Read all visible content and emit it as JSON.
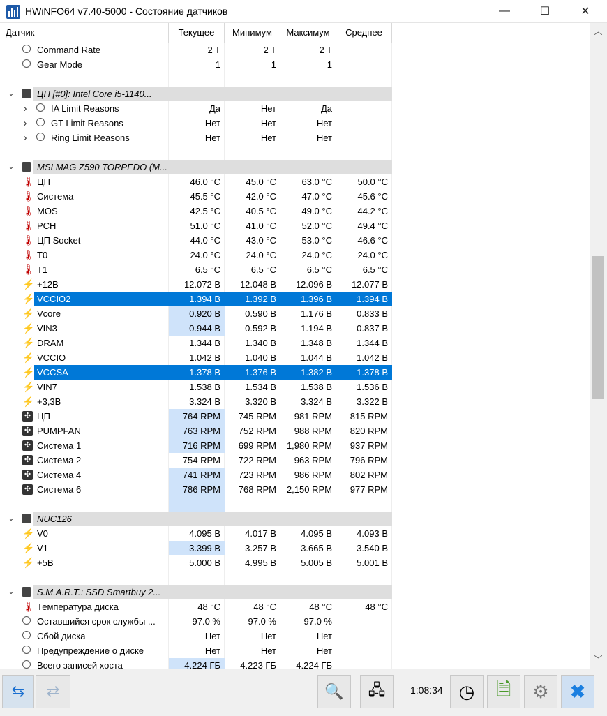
{
  "window": {
    "title": "HWiNFO64 v7.40-5000 - Состояние датчиков",
    "minimize": "—",
    "maximize": "☐",
    "close": "✕"
  },
  "columns": [
    "Датчик",
    "Текущее",
    "Минимум",
    "Максимум",
    "Среднее"
  ],
  "rows": [
    {
      "kind": "sensor",
      "icon": "clock",
      "name": "Command Rate",
      "v": [
        "2 T",
        "2 T",
        "2 T",
        ""
      ]
    },
    {
      "kind": "sensor",
      "icon": "clock",
      "name": "Gear Mode",
      "v": [
        "1",
        "1",
        "1",
        ""
      ]
    },
    {
      "kind": "spacer"
    },
    {
      "kind": "group",
      "name": "ЦП [#0]: Intel Core i5-1140..."
    },
    {
      "kind": "sensor",
      "icon": "clock",
      "expand": true,
      "name": "IA Limit Reasons",
      "v": [
        "Да",
        "Нет",
        "Да",
        ""
      ]
    },
    {
      "kind": "sensor",
      "icon": "clock",
      "expand": true,
      "name": "GT Limit Reasons",
      "v": [
        "Нет",
        "Нет",
        "Нет",
        ""
      ]
    },
    {
      "kind": "sensor",
      "icon": "clock",
      "expand": true,
      "name": "Ring Limit Reasons",
      "v": [
        "Нет",
        "Нет",
        "Нет",
        ""
      ]
    },
    {
      "kind": "spacer"
    },
    {
      "kind": "group",
      "name": "MSI MAG Z590 TORPEDO (M..."
    },
    {
      "kind": "sensor",
      "icon": "therm",
      "name": "ЦП",
      "v": [
        "46.0 °C",
        "45.0 °C",
        "63.0 °C",
        "50.0 °C"
      ]
    },
    {
      "kind": "sensor",
      "icon": "therm",
      "name": "Система",
      "v": [
        "45.5 °C",
        "42.0 °C",
        "47.0 °C",
        "45.6 °C"
      ]
    },
    {
      "kind": "sensor",
      "icon": "therm",
      "name": "MOS",
      "v": [
        "42.5 °C",
        "40.5 °C",
        "49.0 °C",
        "44.2 °C"
      ]
    },
    {
      "kind": "sensor",
      "icon": "therm",
      "name": "PCH",
      "v": [
        "51.0 °C",
        "41.0 °C",
        "52.0 °C",
        "49.4 °C"
      ]
    },
    {
      "kind": "sensor",
      "icon": "therm",
      "name": "ЦП Socket",
      "v": [
        "44.0 °C",
        "43.0 °C",
        "53.0 °C",
        "46.6 °C"
      ]
    },
    {
      "kind": "sensor",
      "icon": "therm",
      "name": "T0",
      "v": [
        "24.0 °C",
        "24.0 °C",
        "24.0 °C",
        "24.0 °C"
      ]
    },
    {
      "kind": "sensor",
      "icon": "therm",
      "name": "T1",
      "v": [
        "6.5 °C",
        "6.5 °C",
        "6.5 °C",
        "6.5 °C"
      ]
    },
    {
      "kind": "sensor",
      "icon": "bolt",
      "name": "+12В",
      "v": [
        "12.072 В",
        "12.048 В",
        "12.096 В",
        "12.077 В"
      ]
    },
    {
      "kind": "sensor",
      "icon": "bolt-gray",
      "selected": true,
      "name": "VCCIO2",
      "v": [
        "1.394 В",
        "1.392 В",
        "1.396 В",
        "1.394 В"
      ]
    },
    {
      "kind": "sensor",
      "icon": "bolt",
      "hl": true,
      "name": "Vcore",
      "v": [
        "0.920 В",
        "0.590 В",
        "1.176 В",
        "0.833 В"
      ]
    },
    {
      "kind": "sensor",
      "icon": "bolt",
      "hl": true,
      "name": "VIN3",
      "v": [
        "0.944 В",
        "0.592 В",
        "1.194 В",
        "0.837 В"
      ]
    },
    {
      "kind": "sensor",
      "icon": "bolt",
      "name": "DRAM",
      "v": [
        "1.344 В",
        "1.340 В",
        "1.348 В",
        "1.344 В"
      ]
    },
    {
      "kind": "sensor",
      "icon": "bolt",
      "name": "VCCIO",
      "v": [
        "1.042 В",
        "1.040 В",
        "1.044 В",
        "1.042 В"
      ]
    },
    {
      "kind": "sensor",
      "icon": "bolt-gray",
      "selected": true,
      "name": "VCCSA",
      "v": [
        "1.378 В",
        "1.376 В",
        "1.382 В",
        "1.378 В"
      ]
    },
    {
      "kind": "sensor",
      "icon": "bolt",
      "name": "VIN7",
      "v": [
        "1.538 В",
        "1.534 В",
        "1.538 В",
        "1.536 В"
      ]
    },
    {
      "kind": "sensor",
      "icon": "bolt",
      "name": "+3,3В",
      "v": [
        "3.324 В",
        "3.320 В",
        "3.324 В",
        "3.322 В"
      ]
    },
    {
      "kind": "sensor",
      "icon": "fan",
      "hl": true,
      "name": "ЦП",
      "v": [
        "764 RPM",
        "745 RPM",
        "981 RPM",
        "815 RPM"
      ]
    },
    {
      "kind": "sensor",
      "icon": "fan",
      "hl": true,
      "name": "PUMPFAN",
      "v": [
        "763 RPM",
        "752 RPM",
        "988 RPM",
        "820 RPM"
      ]
    },
    {
      "kind": "sensor",
      "icon": "fan",
      "hl": true,
      "name": "Система 1",
      "v": [
        "716 RPM",
        "699 RPM",
        "1,980 RPM",
        "937 RPM"
      ]
    },
    {
      "kind": "sensor",
      "icon": "fan",
      "name": "Система 2",
      "v": [
        "754 RPM",
        "722 RPM",
        "963 RPM",
        "796 RPM"
      ]
    },
    {
      "kind": "sensor",
      "icon": "fan",
      "hl": true,
      "name": "Система 4",
      "v": [
        "741 RPM",
        "723 RPM",
        "986 RPM",
        "802 RPM"
      ]
    },
    {
      "kind": "sensor",
      "icon": "fan",
      "hl": true,
      "name": "Система 6",
      "v": [
        "786 RPM",
        "768 RPM",
        "2,150 RPM",
        "977 RPM"
      ]
    },
    {
      "kind": "spacer",
      "hlspacer": true
    },
    {
      "kind": "group",
      "name": "NUC126"
    },
    {
      "kind": "sensor",
      "icon": "bolt",
      "name": "V0",
      "v": [
        "4.095 В",
        "4.017 В",
        "4.095 В",
        "4.093 В"
      ]
    },
    {
      "kind": "sensor",
      "icon": "bolt",
      "hl": true,
      "name": "V1",
      "v": [
        "3.399 В",
        "3.257 В",
        "3.665 В",
        "3.540 В"
      ]
    },
    {
      "kind": "sensor",
      "icon": "bolt",
      "name": "+5В",
      "v": [
        "5.000 В",
        "4.995 В",
        "5.005 В",
        "5.001 В"
      ]
    },
    {
      "kind": "spacer"
    },
    {
      "kind": "group",
      "name": "S.M.A.R.T.: SSD Smartbuy 2..."
    },
    {
      "kind": "sensor",
      "icon": "therm",
      "name": "Температура диска",
      "v": [
        "48 °C",
        "48 °C",
        "48 °C",
        "48 °C"
      ]
    },
    {
      "kind": "sensor",
      "icon": "clock",
      "name": "Оставшийся срок службы ...",
      "v": [
        "97.0 %",
        "97.0 %",
        "97.0 %",
        ""
      ]
    },
    {
      "kind": "sensor",
      "icon": "clock",
      "name": "Сбой диска",
      "v": [
        "Нет",
        "Нет",
        "Нет",
        ""
      ]
    },
    {
      "kind": "sensor",
      "icon": "clock",
      "name": "Предупреждение о диске",
      "v": [
        "Нет",
        "Нет",
        "Нет",
        ""
      ]
    },
    {
      "kind": "sensor",
      "icon": "clock",
      "hl": true,
      "name": "Всего записей хоста",
      "v": [
        "4,224 ГБ",
        "4,223 ГБ",
        "4,224 ГБ",
        ""
      ]
    }
  ],
  "toolbar": {
    "elapsed": "1:08:34"
  }
}
